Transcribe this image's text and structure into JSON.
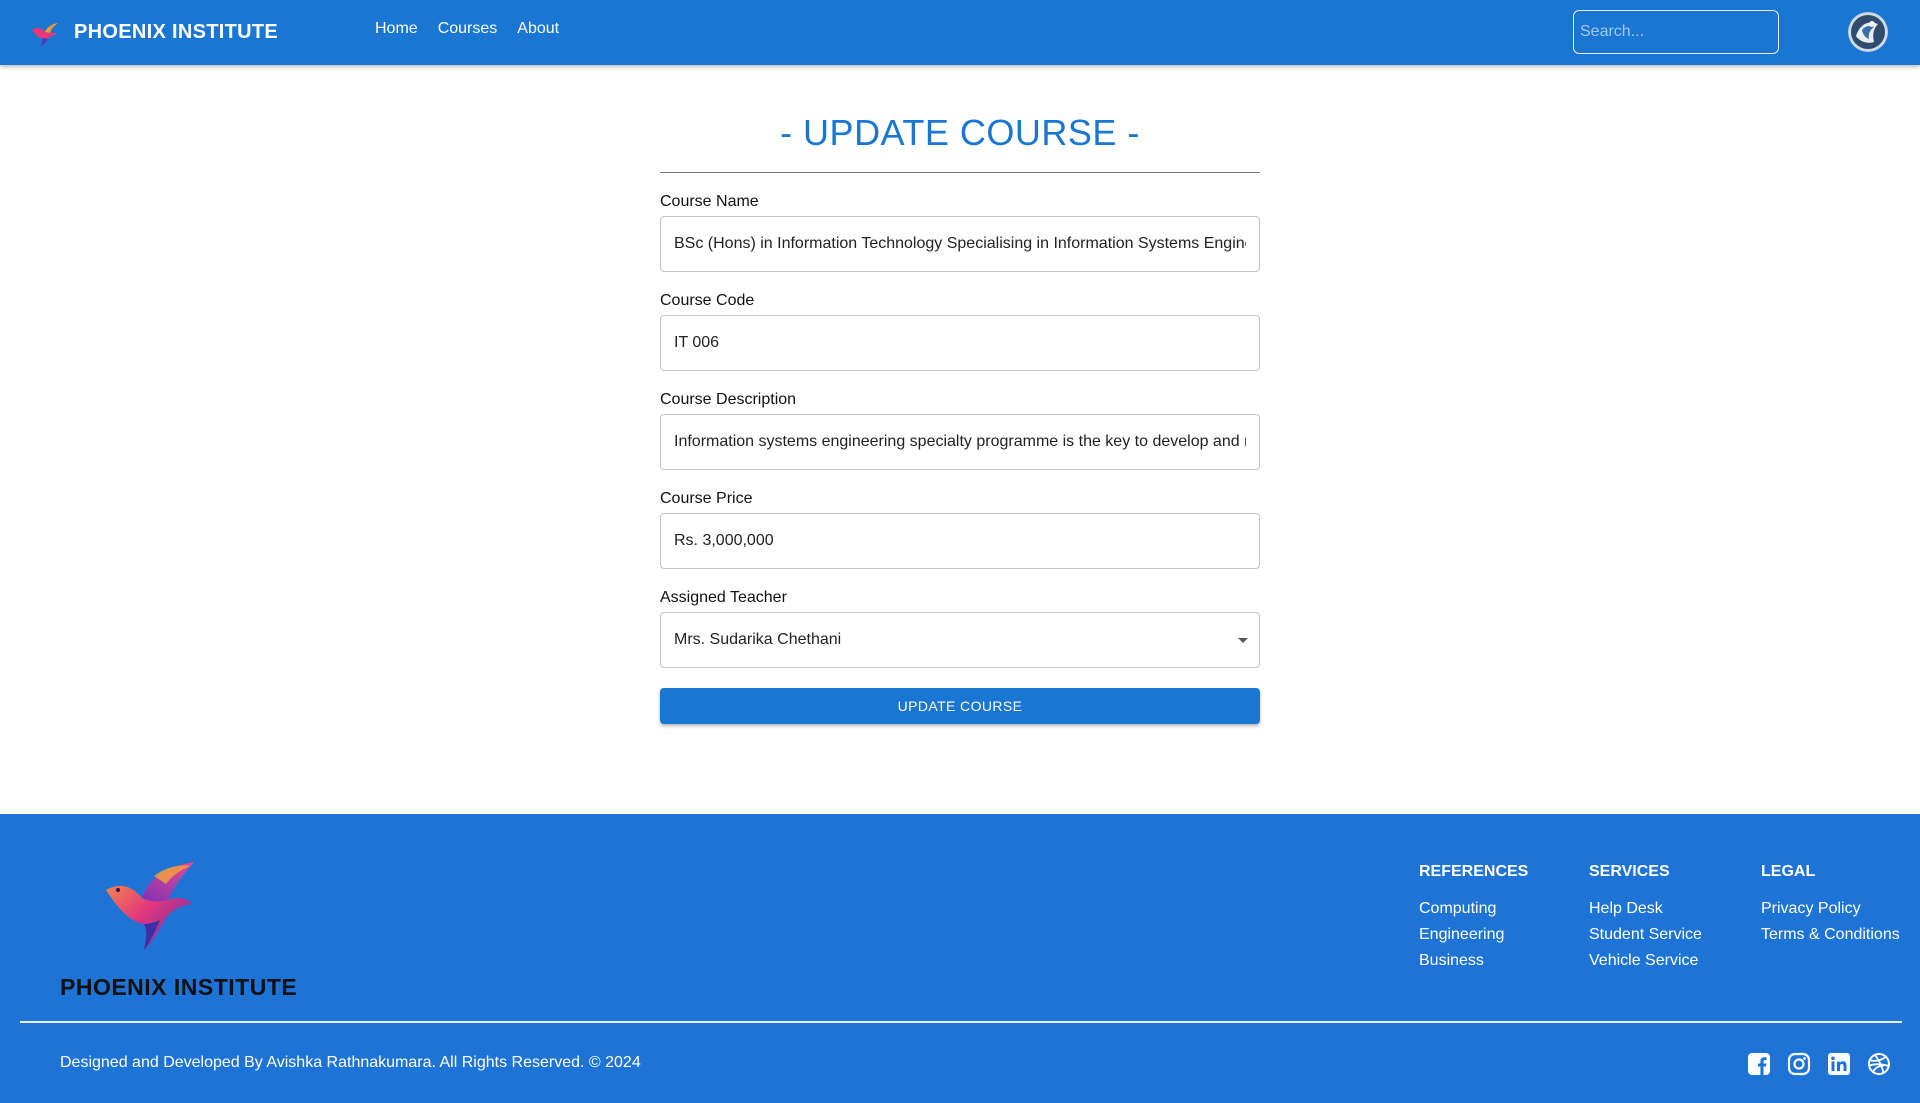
{
  "navbar": {
    "brand": "PHOENIX INSTITUTE",
    "links": [
      "Home",
      "Courses",
      "About"
    ],
    "search_placeholder": "Search...",
    "color": "#1976d2"
  },
  "form": {
    "title": "- UPDATE COURSE -",
    "fields": {
      "course_name": {
        "label": "Course Name",
        "value": "BSc (Hons) in Information Technology Specialising in Information Systems Engineering"
      },
      "course_code": {
        "label": "Course Code",
        "value": "IT 006"
      },
      "course_description": {
        "label": "Course Description",
        "value": "Information systems engineering specialty programme is the key to develop and manage"
      },
      "course_price": {
        "label": "Course Price",
        "value": "Rs. 3,000,000"
      },
      "assigned_teacher": {
        "label": "Assigned Teacher",
        "value": "Mrs. Sudarika Chethani"
      }
    },
    "submit_label": "UPDATE COURSE"
  },
  "footer": {
    "brand": "PHOENIX INSTITUTE",
    "columns": [
      {
        "title": "REFERENCES",
        "links": [
          "Computing",
          "Engineering",
          "Business"
        ]
      },
      {
        "title": "SERVICES",
        "links": [
          "Help Desk",
          "Student Service",
          "Vehicle Service"
        ]
      },
      {
        "title": "LEGAL",
        "links": [
          "Privacy Policy",
          "Terms & Conditions"
        ]
      }
    ],
    "copyright": "Designed and Developed By Avishka Rathnakumara. All Rights Reserved. © 2024",
    "socials": [
      "facebook-icon",
      "instagram-icon",
      "linkedin-icon",
      "dribbble-icon"
    ],
    "color": "#1e74d6"
  }
}
